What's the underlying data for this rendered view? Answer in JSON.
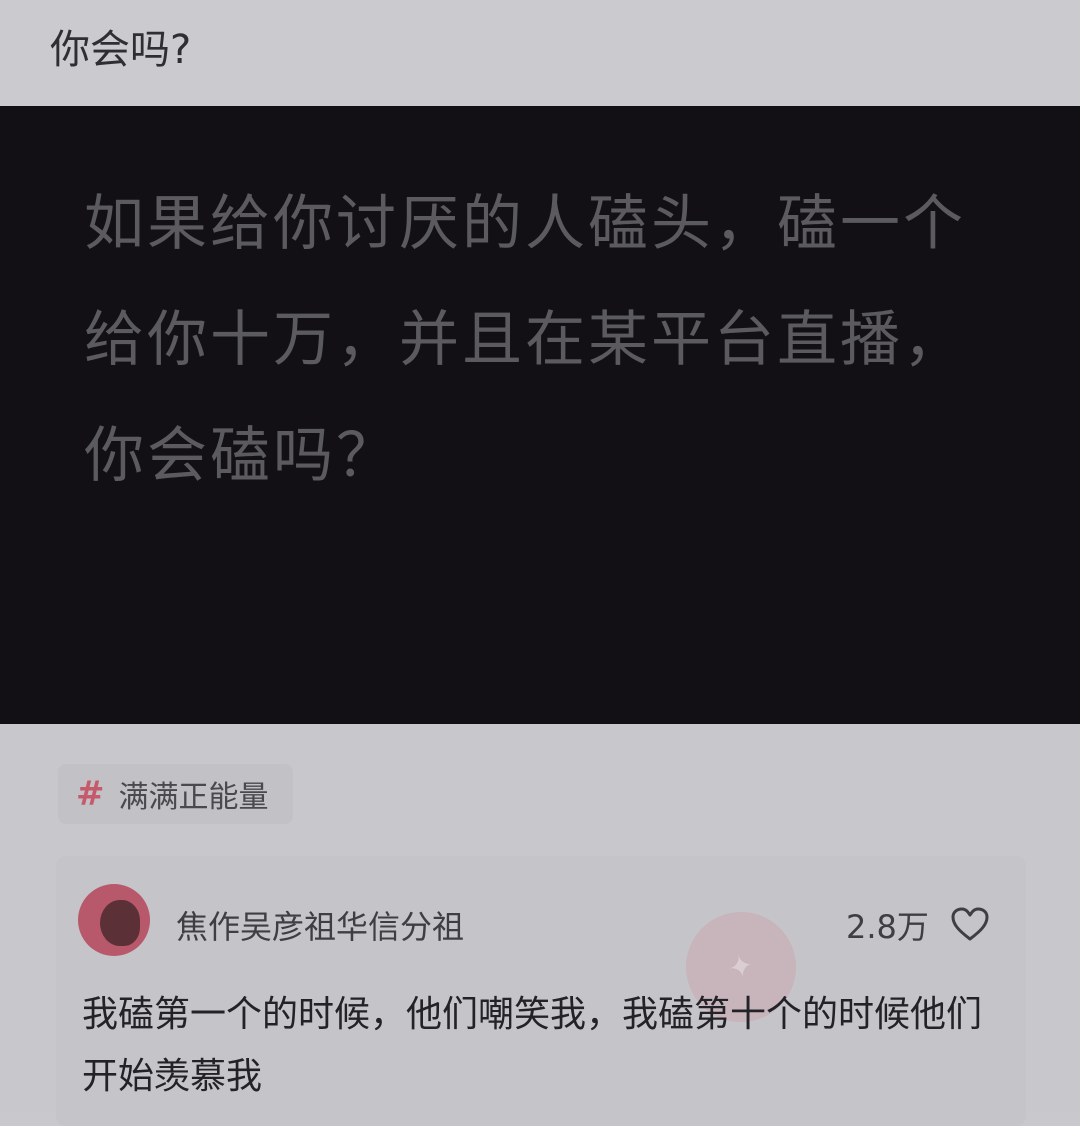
{
  "header": {
    "title": "你会吗?"
  },
  "post": {
    "text": "如果给你讨厌的人磕头，磕一个给你十万，并且在某平台直播，你会磕吗？"
  },
  "topic": {
    "icon": "hashtag-icon",
    "label": "满满正能量"
  },
  "comment": {
    "username": "焦作吴彦祖华信分祖",
    "likes": "2.8万",
    "text": "我磕第一个的时候，他们嘲笑我，我磕第十个的时候他们开始羡慕我"
  },
  "colors": {
    "background": "#c9c8cd",
    "post_card": "#121014",
    "post_text": "#5b5a5e",
    "tag_accent": "#c45a6c",
    "avatar": "#b7586b"
  }
}
